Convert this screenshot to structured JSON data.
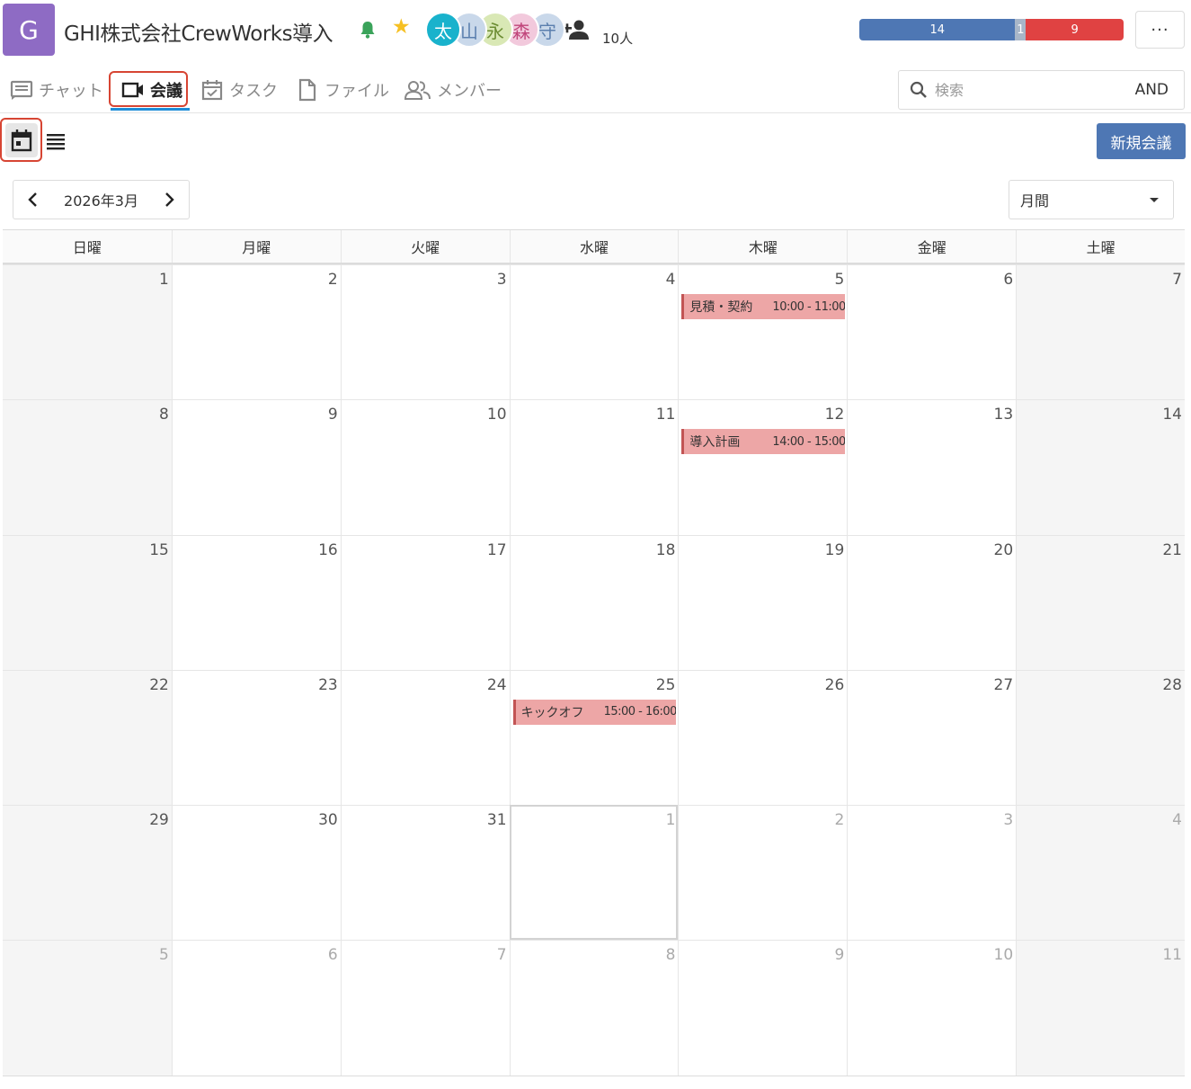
{
  "project": {
    "logo_letter": "G",
    "title": "GHI株式会社CrewWorks導入",
    "member_count": "10人",
    "avatars": [
      {
        "char": "太",
        "bg": "#19b2cc",
        "color": "#ffffff"
      },
      {
        "char": "山",
        "bg": "#c9d8ea",
        "color": "#5b7fae"
      },
      {
        "char": "永",
        "bg": "#d9e8b5",
        "color": "#6b8c32"
      },
      {
        "char": "森",
        "bg": "#f2c9dc",
        "color": "#c0457a"
      },
      {
        "char": "守",
        "bg": "#c9d8ea",
        "color": "#5b7fae"
      }
    ],
    "progress": [
      {
        "value": "14",
        "color": "#4e77b4",
        "fraction": 0.59
      },
      {
        "value": "1",
        "color": "#a8b6c8",
        "fraction": 0.04
      },
      {
        "value": "9",
        "color": "#e04242",
        "fraction": 0.37
      }
    ],
    "more_label": "···"
  },
  "tabs": [
    {
      "label": "チャット",
      "icon": "chat-icon"
    },
    {
      "label": "会議",
      "icon": "video-icon",
      "active": true
    },
    {
      "label": "タスク",
      "icon": "task-icon"
    },
    {
      "label": "ファイル",
      "icon": "file-icon"
    },
    {
      "label": "メンバー",
      "icon": "members-icon"
    }
  ],
  "search": {
    "placeholder": "検索",
    "mode": "AND"
  },
  "toolbar": {
    "new_meeting_label": "新規会議"
  },
  "calendar": {
    "month_label": "2026年3月",
    "period": "月間",
    "weekdays": [
      "日曜",
      "月曜",
      "火曜",
      "水曜",
      "木曜",
      "金曜",
      "土曜"
    ],
    "weeks": [
      [
        {
          "day": "1"
        },
        {
          "day": "2"
        },
        {
          "day": "3"
        },
        {
          "day": "4"
        },
        {
          "day": "5",
          "event": {
            "title": "見積・契約",
            "time": "10:00 - 11:00"
          }
        },
        {
          "day": "6"
        },
        {
          "day": "7"
        }
      ],
      [
        {
          "day": "8"
        },
        {
          "day": "9"
        },
        {
          "day": "10"
        },
        {
          "day": "11"
        },
        {
          "day": "12",
          "event": {
            "title": "導入計画",
            "time": "14:00 - 15:00"
          }
        },
        {
          "day": "13"
        },
        {
          "day": "14"
        }
      ],
      [
        {
          "day": "15"
        },
        {
          "day": "16"
        },
        {
          "day": "17"
        },
        {
          "day": "18"
        },
        {
          "day": "19"
        },
        {
          "day": "20"
        },
        {
          "day": "21"
        }
      ],
      [
        {
          "day": "22"
        },
        {
          "day": "23"
        },
        {
          "day": "24"
        },
        {
          "day": "25",
          "event": {
            "title": "キックオフ",
            "time": "15:00 - 16:00"
          }
        },
        {
          "day": "26"
        },
        {
          "day": "27"
        },
        {
          "day": "28"
        }
      ],
      [
        {
          "day": "29"
        },
        {
          "day": "30"
        },
        {
          "day": "31"
        },
        {
          "day": "1",
          "other": true,
          "today": true
        },
        {
          "day": "2",
          "other": true
        },
        {
          "day": "3",
          "other": true
        },
        {
          "day": "4",
          "other": true
        }
      ],
      [
        {
          "day": "5",
          "other": true
        },
        {
          "day": "6",
          "other": true
        },
        {
          "day": "7",
          "other": true
        },
        {
          "day": "8",
          "other": true
        },
        {
          "day": "9",
          "other": true
        },
        {
          "day": "10",
          "other": true
        },
        {
          "day": "11",
          "other": true
        }
      ]
    ]
  }
}
